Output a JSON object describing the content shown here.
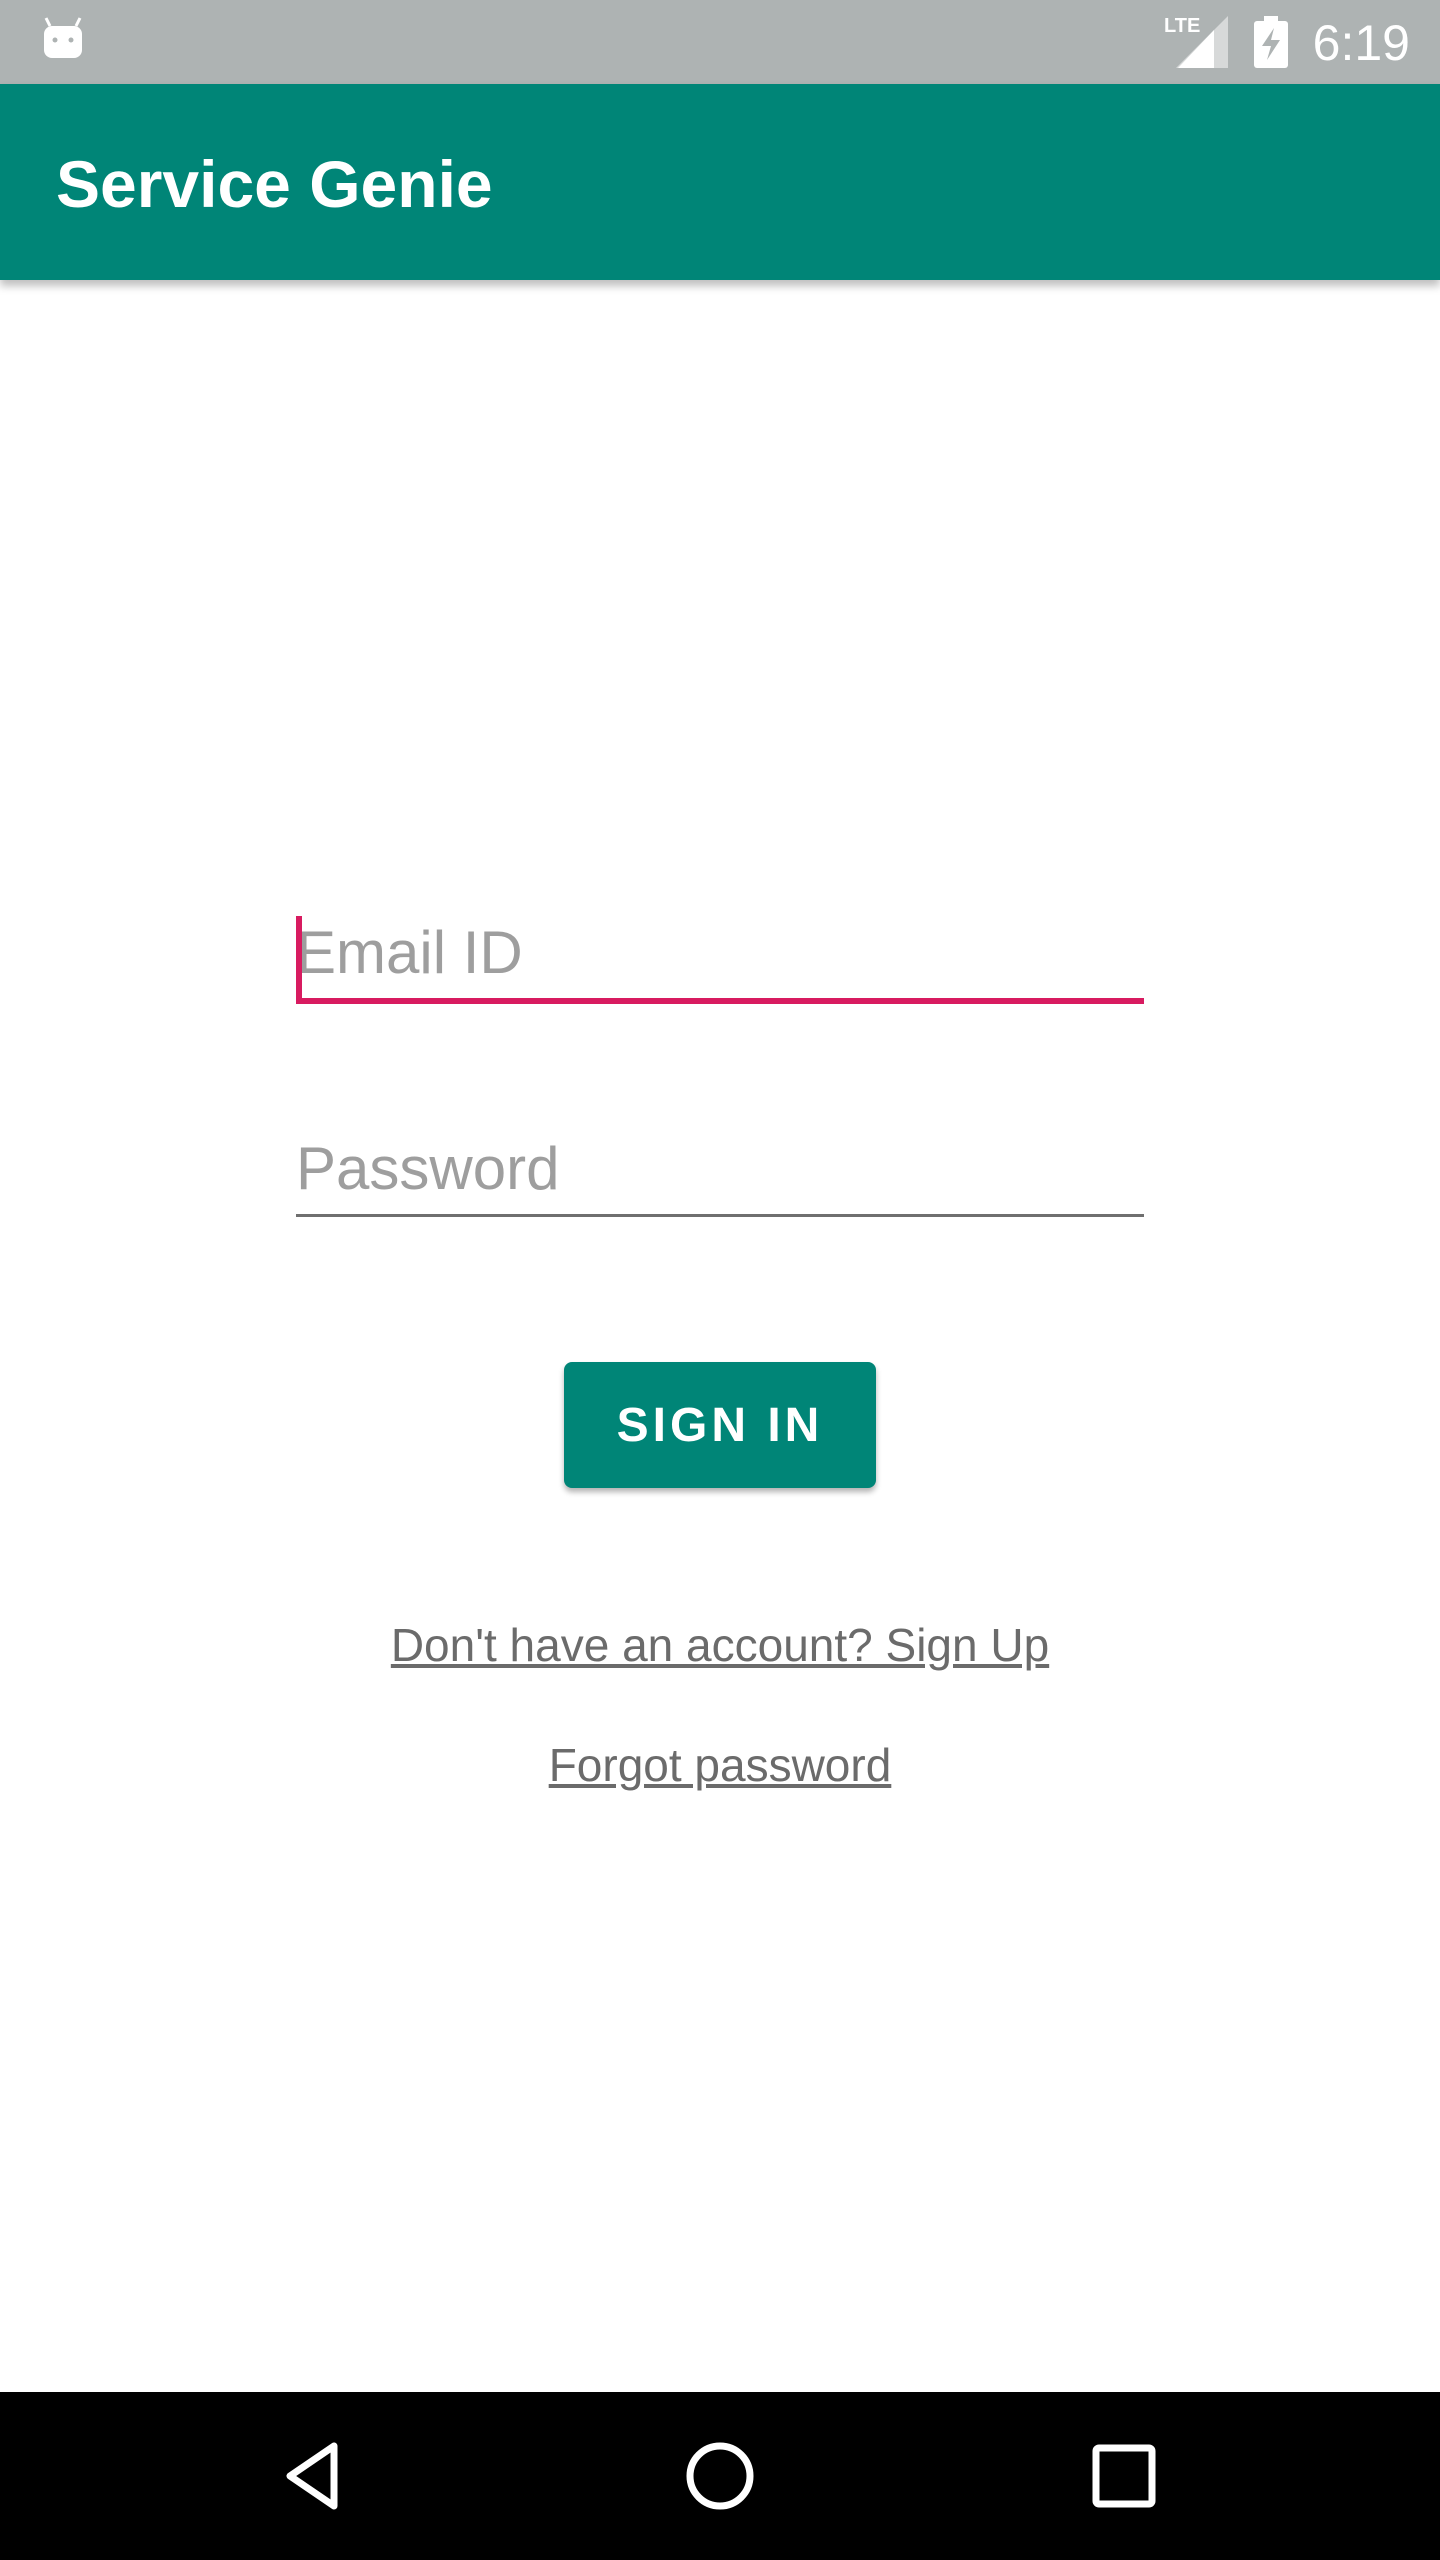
{
  "status_bar": {
    "time": "6:19",
    "network_label": "LTE",
    "icons": [
      "android-icon",
      "lte-signal-icon",
      "battery-charging-icon"
    ]
  },
  "app_bar": {
    "title": "Service Genie",
    "color": "#008577"
  },
  "form": {
    "email": {
      "placeholder": "Email ID",
      "value": ""
    },
    "password": {
      "placeholder": "Password",
      "value": ""
    },
    "sign_in_label": "SIGN IN",
    "signup_link": "Don't have an account? Sign Up",
    "forgot_link": "Forgot password",
    "accent_color": "#D81B60"
  },
  "nav_bar": {
    "icons": [
      "back-icon",
      "home-icon",
      "recents-icon"
    ]
  }
}
